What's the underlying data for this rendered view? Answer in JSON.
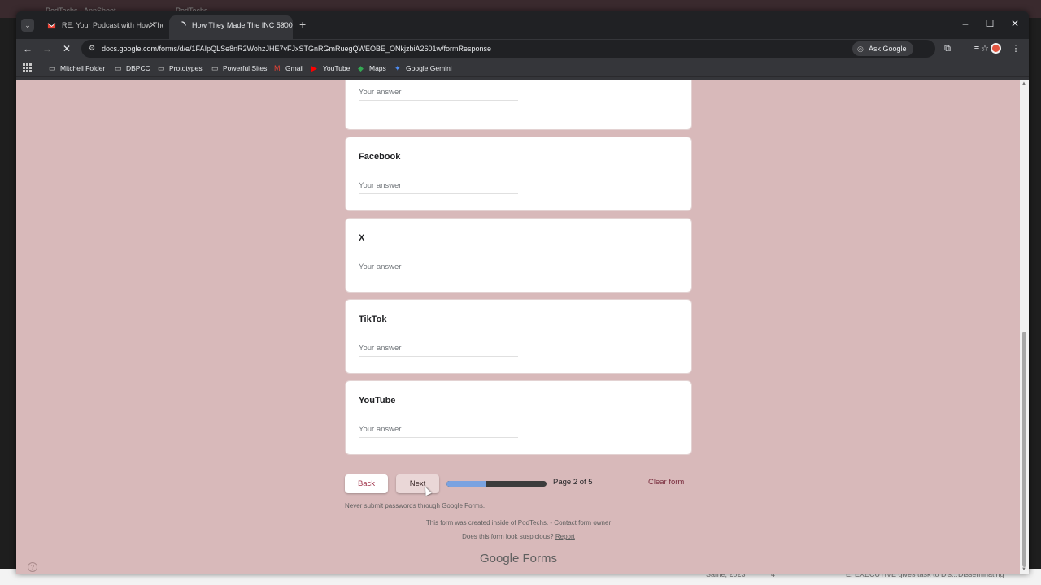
{
  "background": {
    "back_tabs": [
      "PodTechs - AppSheet",
      "PodTechs"
    ],
    "bottom_snippets": [
      "Same, 2023",
      "4",
      "E. EXECUTIVE gives task to Dis...",
      "Disseminating"
    ]
  },
  "browser": {
    "tabs": [
      {
        "label": "RE: Your Podcast with How The",
        "favicon": "gmail-icon",
        "active": false
      },
      {
        "label": "How They Made The INC 5000",
        "favicon": "forms-icon",
        "active": true
      }
    ],
    "url": "docs.google.com/forms/d/e/1FAIpQLSe8nR2WohzJHE7vFJxSTGnRGmRuegQWEOBE_ONkjzbiA2601w/formResponse",
    "ask_google": "Ask Google",
    "bookmarks": [
      {
        "label": "Mitchell Folder",
        "icon": "folder-icon"
      },
      {
        "label": "DBPCC",
        "icon": "folder-icon"
      },
      {
        "label": "Prototypes",
        "icon": "folder-icon"
      },
      {
        "label": "Powerful Sites",
        "icon": "folder-icon"
      },
      {
        "label": "Gmail",
        "icon": "gmail-icon"
      },
      {
        "label": "YouTube",
        "icon": "youtube-icon"
      },
      {
        "label": "Maps",
        "icon": "maps-icon"
      },
      {
        "label": "Google Gemini",
        "icon": "gemini-icon"
      }
    ]
  },
  "form": {
    "questions": [
      {
        "title": "",
        "placeholder": "Your answer"
      },
      {
        "title": "Facebook",
        "placeholder": "Your answer"
      },
      {
        "title": "X",
        "placeholder": "Your answer"
      },
      {
        "title": "TikTok",
        "placeholder": "Your answer"
      },
      {
        "title": "YouTube",
        "placeholder": "Your answer"
      }
    ],
    "back_label": "Back",
    "next_label": "Next",
    "progress_fraction": 0.4,
    "page_label": "Page 2 of 5",
    "clear_label": "Clear form",
    "password_warning": "Never submit passwords through Google Forms.",
    "created_text": "This form was created inside of PodTechs. -",
    "contact_link": "Contact form owner",
    "suspicious_text": "Does this form look suspicious?",
    "report_link": "Report",
    "brand_google": "Google",
    "brand_forms": "Forms"
  },
  "colors": {
    "page_bg": "#d8b9ba",
    "accent": "#a0334a",
    "progress_fill": "#7aa2e0"
  }
}
